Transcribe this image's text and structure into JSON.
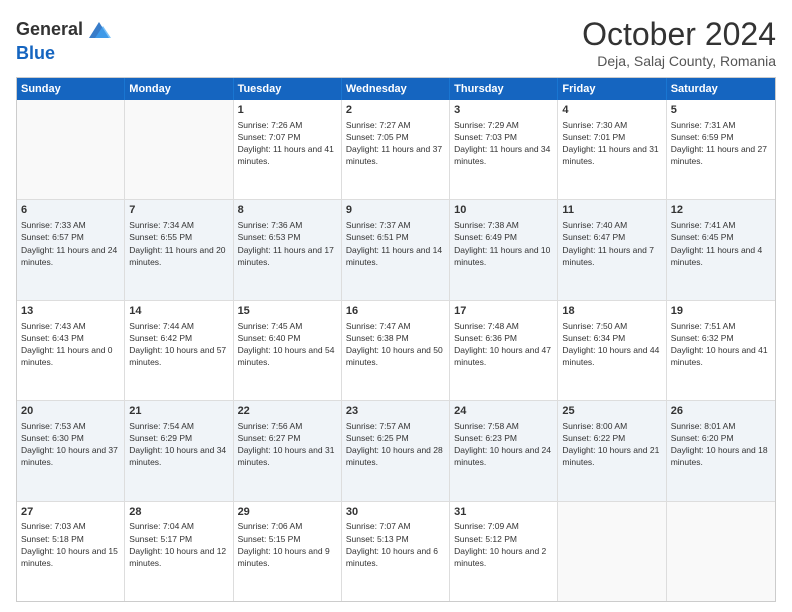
{
  "header": {
    "logo_general": "General",
    "logo_blue": "Blue",
    "month_title": "October 2024",
    "location": "Deja, Salaj County, Romania"
  },
  "calendar": {
    "days_of_week": [
      "Sunday",
      "Monday",
      "Tuesday",
      "Wednesday",
      "Thursday",
      "Friday",
      "Saturday"
    ],
    "weeks": [
      [
        {
          "day": "",
          "sunrise": "",
          "sunset": "",
          "daylight": "",
          "empty": true
        },
        {
          "day": "",
          "sunrise": "",
          "sunset": "",
          "daylight": "",
          "empty": true
        },
        {
          "day": "1",
          "sunrise": "Sunrise: 7:26 AM",
          "sunset": "Sunset: 7:07 PM",
          "daylight": "Daylight: 11 hours and 41 minutes."
        },
        {
          "day": "2",
          "sunrise": "Sunrise: 7:27 AM",
          "sunset": "Sunset: 7:05 PM",
          "daylight": "Daylight: 11 hours and 37 minutes."
        },
        {
          "day": "3",
          "sunrise": "Sunrise: 7:29 AM",
          "sunset": "Sunset: 7:03 PM",
          "daylight": "Daylight: 11 hours and 34 minutes."
        },
        {
          "day": "4",
          "sunrise": "Sunrise: 7:30 AM",
          "sunset": "Sunset: 7:01 PM",
          "daylight": "Daylight: 11 hours and 31 minutes."
        },
        {
          "day": "5",
          "sunrise": "Sunrise: 7:31 AM",
          "sunset": "Sunset: 6:59 PM",
          "daylight": "Daylight: 11 hours and 27 minutes."
        }
      ],
      [
        {
          "day": "6",
          "sunrise": "Sunrise: 7:33 AM",
          "sunset": "Sunset: 6:57 PM",
          "daylight": "Daylight: 11 hours and 24 minutes."
        },
        {
          "day": "7",
          "sunrise": "Sunrise: 7:34 AM",
          "sunset": "Sunset: 6:55 PM",
          "daylight": "Daylight: 11 hours and 20 minutes."
        },
        {
          "day": "8",
          "sunrise": "Sunrise: 7:36 AM",
          "sunset": "Sunset: 6:53 PM",
          "daylight": "Daylight: 11 hours and 17 minutes."
        },
        {
          "day": "9",
          "sunrise": "Sunrise: 7:37 AM",
          "sunset": "Sunset: 6:51 PM",
          "daylight": "Daylight: 11 hours and 14 minutes."
        },
        {
          "day": "10",
          "sunrise": "Sunrise: 7:38 AM",
          "sunset": "Sunset: 6:49 PM",
          "daylight": "Daylight: 11 hours and 10 minutes."
        },
        {
          "day": "11",
          "sunrise": "Sunrise: 7:40 AM",
          "sunset": "Sunset: 6:47 PM",
          "daylight": "Daylight: 11 hours and 7 minutes."
        },
        {
          "day": "12",
          "sunrise": "Sunrise: 7:41 AM",
          "sunset": "Sunset: 6:45 PM",
          "daylight": "Daylight: 11 hours and 4 minutes."
        }
      ],
      [
        {
          "day": "13",
          "sunrise": "Sunrise: 7:43 AM",
          "sunset": "Sunset: 6:43 PM",
          "daylight": "Daylight: 11 hours and 0 minutes."
        },
        {
          "day": "14",
          "sunrise": "Sunrise: 7:44 AM",
          "sunset": "Sunset: 6:42 PM",
          "daylight": "Daylight: 10 hours and 57 minutes."
        },
        {
          "day": "15",
          "sunrise": "Sunrise: 7:45 AM",
          "sunset": "Sunset: 6:40 PM",
          "daylight": "Daylight: 10 hours and 54 minutes."
        },
        {
          "day": "16",
          "sunrise": "Sunrise: 7:47 AM",
          "sunset": "Sunset: 6:38 PM",
          "daylight": "Daylight: 10 hours and 50 minutes."
        },
        {
          "day": "17",
          "sunrise": "Sunrise: 7:48 AM",
          "sunset": "Sunset: 6:36 PM",
          "daylight": "Daylight: 10 hours and 47 minutes."
        },
        {
          "day": "18",
          "sunrise": "Sunrise: 7:50 AM",
          "sunset": "Sunset: 6:34 PM",
          "daylight": "Daylight: 10 hours and 44 minutes."
        },
        {
          "day": "19",
          "sunrise": "Sunrise: 7:51 AM",
          "sunset": "Sunset: 6:32 PM",
          "daylight": "Daylight: 10 hours and 41 minutes."
        }
      ],
      [
        {
          "day": "20",
          "sunrise": "Sunrise: 7:53 AM",
          "sunset": "Sunset: 6:30 PM",
          "daylight": "Daylight: 10 hours and 37 minutes."
        },
        {
          "day": "21",
          "sunrise": "Sunrise: 7:54 AM",
          "sunset": "Sunset: 6:29 PM",
          "daylight": "Daylight: 10 hours and 34 minutes."
        },
        {
          "day": "22",
          "sunrise": "Sunrise: 7:56 AM",
          "sunset": "Sunset: 6:27 PM",
          "daylight": "Daylight: 10 hours and 31 minutes."
        },
        {
          "day": "23",
          "sunrise": "Sunrise: 7:57 AM",
          "sunset": "Sunset: 6:25 PM",
          "daylight": "Daylight: 10 hours and 28 minutes."
        },
        {
          "day": "24",
          "sunrise": "Sunrise: 7:58 AM",
          "sunset": "Sunset: 6:23 PM",
          "daylight": "Daylight: 10 hours and 24 minutes."
        },
        {
          "day": "25",
          "sunrise": "Sunrise: 8:00 AM",
          "sunset": "Sunset: 6:22 PM",
          "daylight": "Daylight: 10 hours and 21 minutes."
        },
        {
          "day": "26",
          "sunrise": "Sunrise: 8:01 AM",
          "sunset": "Sunset: 6:20 PM",
          "daylight": "Daylight: 10 hours and 18 minutes."
        }
      ],
      [
        {
          "day": "27",
          "sunrise": "Sunrise: 7:03 AM",
          "sunset": "Sunset: 5:18 PM",
          "daylight": "Daylight: 10 hours and 15 minutes."
        },
        {
          "day": "28",
          "sunrise": "Sunrise: 7:04 AM",
          "sunset": "Sunset: 5:17 PM",
          "daylight": "Daylight: 10 hours and 12 minutes."
        },
        {
          "day": "29",
          "sunrise": "Sunrise: 7:06 AM",
          "sunset": "Sunset: 5:15 PM",
          "daylight": "Daylight: 10 hours and 9 minutes."
        },
        {
          "day": "30",
          "sunrise": "Sunrise: 7:07 AM",
          "sunset": "Sunset: 5:13 PM",
          "daylight": "Daylight: 10 hours and 6 minutes."
        },
        {
          "day": "31",
          "sunrise": "Sunrise: 7:09 AM",
          "sunset": "Sunset: 5:12 PM",
          "daylight": "Daylight: 10 hours and 2 minutes."
        },
        {
          "day": "",
          "sunrise": "",
          "sunset": "",
          "daylight": "",
          "empty": true
        },
        {
          "day": "",
          "sunrise": "",
          "sunset": "",
          "daylight": "",
          "empty": true
        }
      ]
    ]
  }
}
